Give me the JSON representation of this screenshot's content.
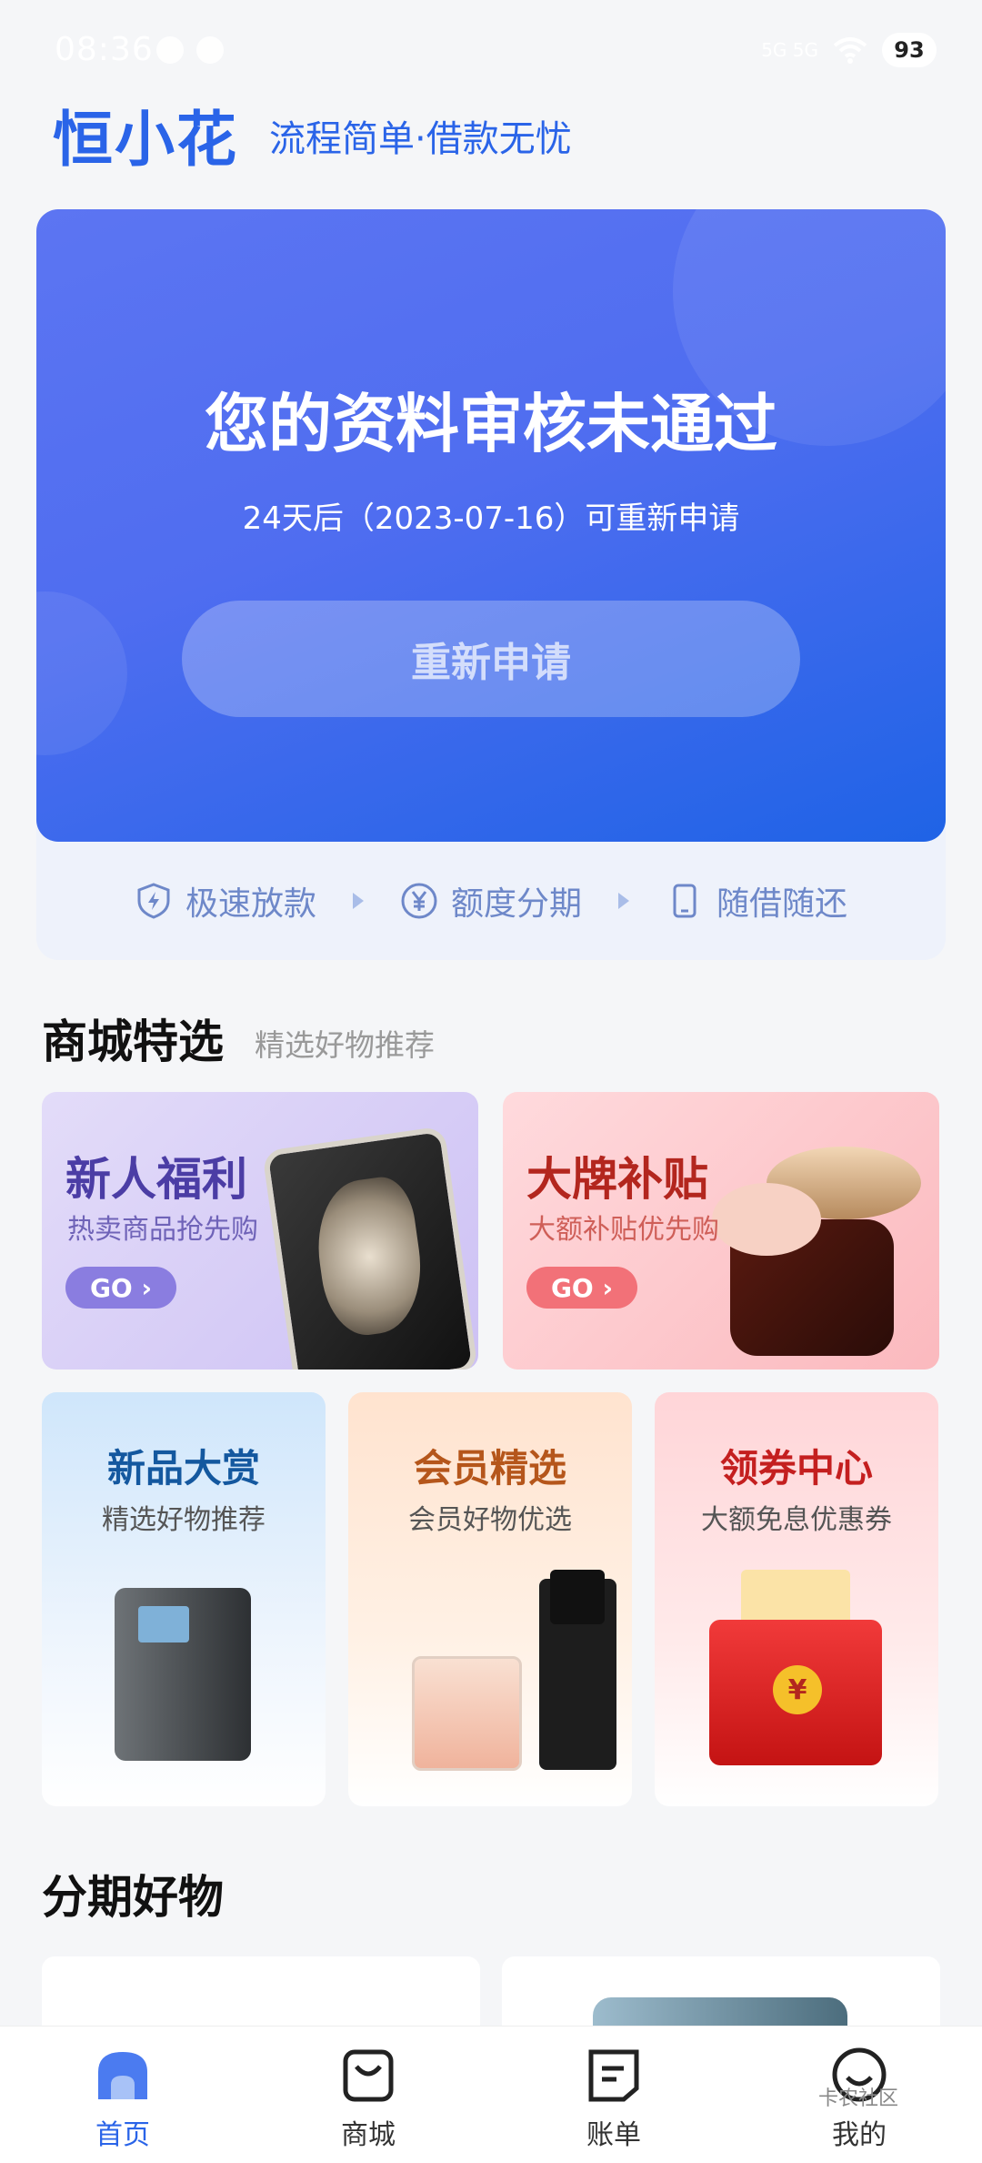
{
  "status_bar": {
    "time": "08:36",
    "signal": "5G 5G",
    "battery": "93"
  },
  "header": {
    "logo": "恒小花",
    "slogan": "流程简单·借款无忧"
  },
  "hero": {
    "title": "您的资料审核未通过",
    "subtitle": "24天后（2023-07-16）可重新申请",
    "button": "重新申请"
  },
  "features": [
    "极速放款",
    "额度分期",
    "随借随还"
  ],
  "mall": {
    "title": "商城特选",
    "subtitle": "精选好物推荐",
    "big_cards": [
      {
        "title": "新人福利",
        "subtitle": "热卖商品抢先购",
        "go": "GO"
      },
      {
        "title": "大牌补贴",
        "subtitle": "大额补贴优先购",
        "go": "GO"
      }
    ],
    "small_cards": [
      {
        "title": "新品大赏",
        "subtitle": "精选好物推荐"
      },
      {
        "title": "会员精选",
        "subtitle": "会员好物优选"
      },
      {
        "title": "领券中心",
        "subtitle": "大额免息优惠券"
      }
    ]
  },
  "installment": {
    "title": "分期好物"
  },
  "tabbar": [
    {
      "label": "首页",
      "active": true
    },
    {
      "label": "商城",
      "active": false
    },
    {
      "label": "账单",
      "active": false
    },
    {
      "label": "我的",
      "active": false
    }
  ],
  "watermark": "卡农社区",
  "colors": {
    "brand": "#2a64e8",
    "hero_start": "#5c75f2",
    "hero_end": "#1f63e6"
  }
}
